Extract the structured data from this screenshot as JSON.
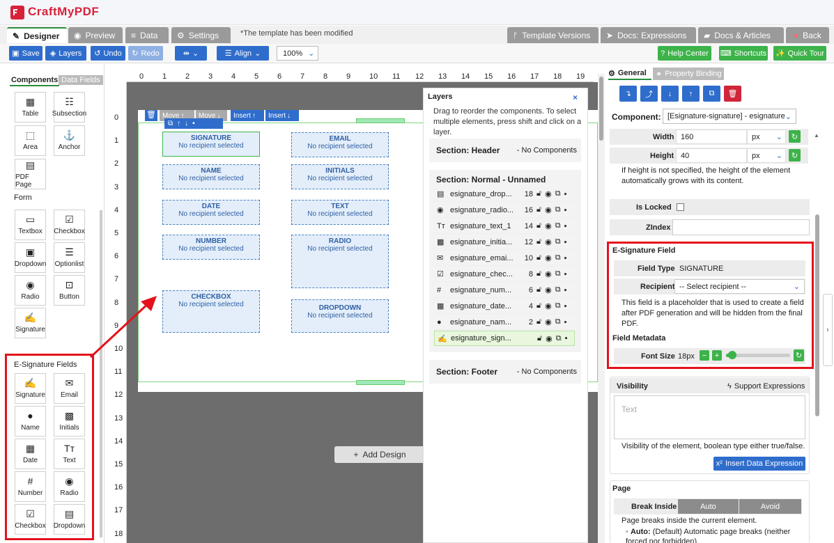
{
  "app": {
    "logo": "CraftMyPDF"
  },
  "tabs": [
    {
      "label": "Designer"
    },
    {
      "label": "Preview"
    },
    {
      "label": "Data"
    },
    {
      "label": "Settings"
    }
  ],
  "modified_note": "*The template has been modified",
  "right_tabs": [
    {
      "label": "Template Versions"
    },
    {
      "label": "Docs: Expressions"
    },
    {
      "label": "Docs & Articles"
    },
    {
      "label": "Back"
    }
  ],
  "toolbar": {
    "save": "Save",
    "layers": "Layers",
    "undo": "Undo",
    "redo": "Redo",
    "align": "Align",
    "zoom": "100%",
    "help": "Help Center",
    "shortcuts": "Shortcuts",
    "tour": "Quick Tour"
  },
  "left": {
    "tab_components": "Components",
    "tab_data": "Data Fields",
    "basic": [
      {
        "label": "Table",
        "icon": "table-icon"
      },
      {
        "label": "Subsection",
        "icon": "subsection-icon"
      },
      {
        "label": "Area",
        "icon": "area-icon"
      },
      {
        "label": "Anchor",
        "icon": "anchor-icon"
      },
      {
        "label": "PDF Page",
        "icon": "pdf-icon"
      }
    ],
    "form_title": "Form",
    "form": [
      {
        "label": "Textbox"
      },
      {
        "label": "Checkbox"
      },
      {
        "label": "Dropdown"
      },
      {
        "label": "Optionlist"
      },
      {
        "label": "Radio"
      },
      {
        "label": "Button"
      },
      {
        "label": "Signature"
      }
    ],
    "esig_title": "E-Signature Fields",
    "esig": [
      {
        "label": "Signature"
      },
      {
        "label": "Email"
      },
      {
        "label": "Name"
      },
      {
        "label": "Initials"
      },
      {
        "label": "Date"
      },
      {
        "label": "Text"
      },
      {
        "label": "Number"
      },
      {
        "label": "Radio"
      },
      {
        "label": "Checkbox"
      },
      {
        "label": "Dropdown"
      }
    ]
  },
  "ruler_top": [
    "0",
    "1",
    "2",
    "3",
    "4",
    "5",
    "6",
    "7",
    "8",
    "9",
    "10",
    "11",
    "12",
    "13",
    "14",
    "15",
    "16",
    "17",
    "18",
    "19"
  ],
  "ruler_left": [
    "0",
    "1",
    "2",
    "3",
    "4",
    "5",
    "6",
    "7",
    "8",
    "9",
    "10",
    "11",
    "12",
    "13",
    "14",
    "15",
    "16",
    "17",
    "18"
  ],
  "canvas": {
    "move_up": "Move",
    "move_down": "Move",
    "insert1": "Insert",
    "insert2": "Insert",
    "add_design": "Add Design",
    "fields": [
      {
        "title": "SIGNATURE",
        "sub": "No recipient selected"
      },
      {
        "title": "EMAIL",
        "sub": "No recipient selected"
      },
      {
        "title": "NAME",
        "sub": "No recipient selected"
      },
      {
        "title": "INITIALS",
        "sub": "No recipient selected"
      },
      {
        "title": "DATE",
        "sub": "No recipient selected"
      },
      {
        "title": "TEXT",
        "sub": "No recipient selected"
      },
      {
        "title": "NUMBER",
        "sub": "No recipient selected"
      },
      {
        "title": "RADIO",
        "sub": "No recipient selected"
      },
      {
        "title": "CHECKBOX",
        "sub": "No recipient selected"
      },
      {
        "title": "DROPDOWN",
        "sub": "No recipient selected"
      }
    ]
  },
  "layers": {
    "title": "Layers",
    "desc": "Drag to reorder the components. To select multiple elements, press shift and click on a layer.",
    "header": {
      "title": "Section: Header",
      "note": "- No Components"
    },
    "normal": {
      "title": "Section: Normal - Unnamed"
    },
    "footer": {
      "title": "Section: Footer",
      "note": "- No Components"
    },
    "rows": [
      {
        "name": "esignature_drop...",
        "count": "18"
      },
      {
        "name": "esignature_radio...",
        "count": "16"
      },
      {
        "name": "esignature_text_1",
        "count": "14"
      },
      {
        "name": "esignature_initia...",
        "count": "12"
      },
      {
        "name": "esignature_emai...",
        "count": "10"
      },
      {
        "name": "esignature_chec...",
        "count": "8"
      },
      {
        "name": "esignature_num...",
        "count": "6"
      },
      {
        "name": "esignature_date...",
        "count": "4"
      },
      {
        "name": "esignature_nam...",
        "count": "2"
      },
      {
        "name": "esignature_sign...",
        "count": ""
      }
    ]
  },
  "props": {
    "tab_general": "General",
    "tab_binding": "Property Binding",
    "component_label": "Component:",
    "component_value": "[Esignature-signature] - esignature",
    "width_label": "Width",
    "width_value": "160",
    "width_unit": "px",
    "height_label": "Height",
    "height_value": "40",
    "height_unit": "px",
    "height_note": "If height is not specified, the height of the element automatically grows with its content.",
    "locked_label": "Is Locked",
    "zindex_label": "ZIndex",
    "esig_title": "E-Signature Field",
    "field_type_label": "Field Type",
    "field_type_value": "SIGNATURE",
    "recipient_label": "Recipient",
    "recipient_value": "-- Select recipient --",
    "esig_note": "This field is a placeholder that is used to create a field after PDF generation and will be hidden from the final PDF.",
    "metadata_title": "Field Metadata",
    "font_size_label": "Font Size",
    "font_size_value": "18px",
    "font_size_level": 0.1,
    "visibility_title": "Visibility",
    "support_expr": "Support Expressions",
    "visibility_placeholder": "Text",
    "visibility_note": "Visibility of the element, boolean type either true/false.",
    "insert_expr": "Insert Data Expression",
    "page_title": "Page",
    "break_inside_label": "Break Inside",
    "break_auto": "Auto",
    "break_avoid": "Avoid",
    "page_note": "Page breaks inside the current element.",
    "auto_bold": "Auto:",
    "auto_note": "(Default) Automatic page breaks (neither forced nor forbidden)."
  },
  "colors": {
    "brand": "#d8223a",
    "primary": "#2f6dcc",
    "green": "#3db34a",
    "highlight": "#e3121b"
  }
}
